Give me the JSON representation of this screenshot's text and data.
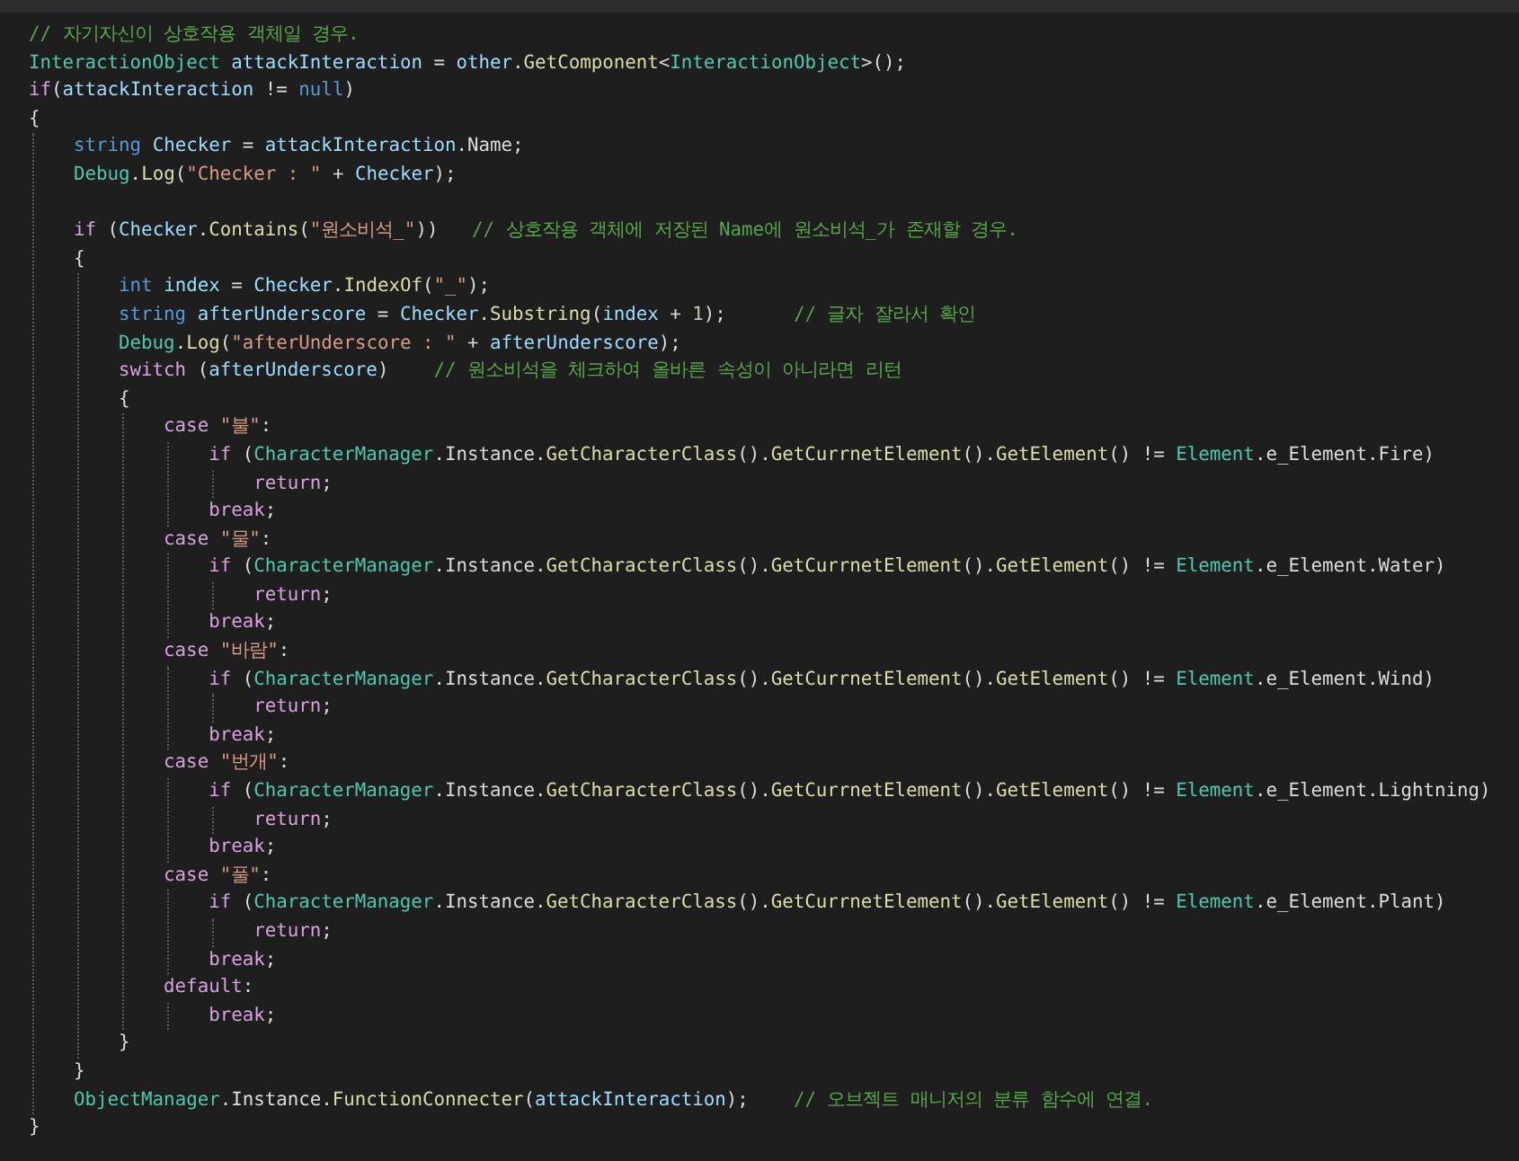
{
  "editor": {
    "lines": [
      {
        "kind": "code",
        "tokens": [
          {
            "kind": "comment",
            "text": "// 자기자신이 상호작용 객체일 경우."
          }
        ]
      },
      {
        "kind": "code",
        "tokens": [
          {
            "kind": "type",
            "text": "InteractionObject "
          },
          {
            "kind": "variable",
            "text": "attackInteraction"
          },
          {
            "kind": "plain",
            "text": " = "
          },
          {
            "kind": "variable",
            "text": "other"
          },
          {
            "kind": "plain",
            "text": "."
          },
          {
            "kind": "method",
            "text": "GetComponent"
          },
          {
            "kind": "plain",
            "text": "<"
          },
          {
            "kind": "type",
            "text": "InteractionObject"
          },
          {
            "kind": "plain",
            "text": ">();"
          }
        ]
      },
      {
        "kind": "code",
        "tokens": [
          {
            "kind": "control",
            "text": "if"
          },
          {
            "kind": "plain",
            "text": "("
          },
          {
            "kind": "variable",
            "text": "attackInteraction"
          },
          {
            "kind": "plain",
            "text": " != "
          },
          {
            "kind": "keyword",
            "text": "null"
          },
          {
            "kind": "plain",
            "text": ")"
          }
        ]
      },
      {
        "kind": "code",
        "tokens": [
          {
            "kind": "plain",
            "text": "{"
          }
        ],
        "children": [
          {
            "kind": "code",
            "tokens": [
              {
                "kind": "keyword",
                "text": "string "
              },
              {
                "kind": "variable",
                "text": "Checker"
              },
              {
                "kind": "plain",
                "text": " = "
              },
              {
                "kind": "variable",
                "text": "attackInteraction"
              },
              {
                "kind": "plain",
                "text": ".Name;"
              }
            ]
          },
          {
            "kind": "code",
            "tokens": [
              {
                "kind": "type",
                "text": "Debug"
              },
              {
                "kind": "plain",
                "text": "."
              },
              {
                "kind": "method",
                "text": "Log"
              },
              {
                "kind": "plain",
                "text": "("
              },
              {
                "kind": "string",
                "text": "\"Checker : \""
              },
              {
                "kind": "plain",
                "text": " + "
              },
              {
                "kind": "variable",
                "text": "Checker"
              },
              {
                "kind": "plain",
                "text": ");"
              }
            ]
          },
          {
            "kind": "blank"
          },
          {
            "kind": "code",
            "tokens": [
              {
                "kind": "control",
                "text": "if"
              },
              {
                "kind": "plain",
                "text": " ("
              },
              {
                "kind": "variable",
                "text": "Checker"
              },
              {
                "kind": "plain",
                "text": "."
              },
              {
                "kind": "method",
                "text": "Contains"
              },
              {
                "kind": "plain",
                "text": "("
              },
              {
                "kind": "string",
                "text": "\"원소비석_\""
              },
              {
                "kind": "plain",
                "text": "))   "
              },
              {
                "kind": "comment",
                "text": "// 상호작용 객체에 저장된 Name에 원소비석_가 존재할 경우."
              }
            ]
          },
          {
            "kind": "code",
            "tokens": [
              {
                "kind": "plain",
                "text": "{"
              }
            ],
            "children": [
              {
                "kind": "code",
                "tokens": [
                  {
                    "kind": "keyword",
                    "text": "int "
                  },
                  {
                    "kind": "variable",
                    "text": "index"
                  },
                  {
                    "kind": "plain",
                    "text": " = "
                  },
                  {
                    "kind": "variable",
                    "text": "Checker"
                  },
                  {
                    "kind": "plain",
                    "text": "."
                  },
                  {
                    "kind": "method",
                    "text": "IndexOf"
                  },
                  {
                    "kind": "plain",
                    "text": "("
                  },
                  {
                    "kind": "string",
                    "text": "\"_\""
                  },
                  {
                    "kind": "plain",
                    "text": ");"
                  }
                ]
              },
              {
                "kind": "code",
                "tokens": [
                  {
                    "kind": "keyword",
                    "text": "string "
                  },
                  {
                    "kind": "variable",
                    "text": "afterUnderscore"
                  },
                  {
                    "kind": "plain",
                    "text": " = "
                  },
                  {
                    "kind": "variable",
                    "text": "Checker"
                  },
                  {
                    "kind": "plain",
                    "text": "."
                  },
                  {
                    "kind": "method",
                    "text": "Substring"
                  },
                  {
                    "kind": "plain",
                    "text": "("
                  },
                  {
                    "kind": "variable",
                    "text": "index"
                  },
                  {
                    "kind": "plain",
                    "text": " + "
                  },
                  {
                    "kind": "number",
                    "text": "1"
                  },
                  {
                    "kind": "plain",
                    "text": ");      "
                  },
                  {
                    "kind": "comment",
                    "text": "// 글자 잘라서 확인"
                  }
                ]
              },
              {
                "kind": "code",
                "tokens": [
                  {
                    "kind": "type",
                    "text": "Debug"
                  },
                  {
                    "kind": "plain",
                    "text": "."
                  },
                  {
                    "kind": "method",
                    "text": "Log"
                  },
                  {
                    "kind": "plain",
                    "text": "("
                  },
                  {
                    "kind": "string",
                    "text": "\"afterUnderscore : \""
                  },
                  {
                    "kind": "plain",
                    "text": " + "
                  },
                  {
                    "kind": "variable",
                    "text": "afterUnderscore"
                  },
                  {
                    "kind": "plain",
                    "text": ");"
                  }
                ]
              },
              {
                "kind": "code",
                "tokens": [
                  {
                    "kind": "control",
                    "text": "switch"
                  },
                  {
                    "kind": "plain",
                    "text": " ("
                  },
                  {
                    "kind": "variable",
                    "text": "afterUnderscore"
                  },
                  {
                    "kind": "plain",
                    "text": ")    "
                  },
                  {
                    "kind": "comment",
                    "text": "// 원소비석을 체크하여 올바른 속성이 아니라면 리턴"
                  }
                ]
              },
              {
                "kind": "code",
                "tokens": [
                  {
                    "kind": "plain",
                    "text": "{"
                  }
                ],
                "children": [
                  {
                    "kind": "code",
                    "tokens": [
                      {
                        "kind": "control",
                        "text": "case "
                      },
                      {
                        "kind": "string",
                        "text": "\"불\""
                      },
                      {
                        "kind": "plain",
                        "text": ":"
                      }
                    ],
                    "children": [
                      {
                        "kind": "code",
                        "tokens": [
                          {
                            "kind": "control",
                            "text": "if"
                          },
                          {
                            "kind": "plain",
                            "text": " ("
                          },
                          {
                            "kind": "type",
                            "text": "CharacterManager"
                          },
                          {
                            "kind": "plain",
                            "text": ".Instance."
                          },
                          {
                            "kind": "method",
                            "text": "GetCharacterClass"
                          },
                          {
                            "kind": "plain",
                            "text": "()."
                          },
                          {
                            "kind": "method",
                            "text": "GetCurrnetElement"
                          },
                          {
                            "kind": "plain",
                            "text": "()."
                          },
                          {
                            "kind": "method",
                            "text": "GetElement"
                          },
                          {
                            "kind": "plain",
                            "text": "() != "
                          },
                          {
                            "kind": "type",
                            "text": "Element"
                          },
                          {
                            "kind": "plain",
                            "text": ".e_Element.Fire)"
                          }
                        ],
                        "children": [
                          {
                            "kind": "code",
                            "tokens": [
                              {
                                "kind": "control",
                                "text": "return"
                              },
                              {
                                "kind": "plain",
                                "text": ";"
                              }
                            ]
                          }
                        ]
                      },
                      {
                        "kind": "code",
                        "tokens": [
                          {
                            "kind": "control",
                            "text": "break"
                          },
                          {
                            "kind": "plain",
                            "text": ";"
                          }
                        ]
                      }
                    ]
                  },
                  {
                    "kind": "code",
                    "tokens": [
                      {
                        "kind": "control",
                        "text": "case "
                      },
                      {
                        "kind": "string",
                        "text": "\"물\""
                      },
                      {
                        "kind": "plain",
                        "text": ":"
                      }
                    ],
                    "children": [
                      {
                        "kind": "code",
                        "tokens": [
                          {
                            "kind": "control",
                            "text": "if"
                          },
                          {
                            "kind": "plain",
                            "text": " ("
                          },
                          {
                            "kind": "type",
                            "text": "CharacterManager"
                          },
                          {
                            "kind": "plain",
                            "text": ".Instance."
                          },
                          {
                            "kind": "method",
                            "text": "GetCharacterClass"
                          },
                          {
                            "kind": "plain",
                            "text": "()."
                          },
                          {
                            "kind": "method",
                            "text": "GetCurrnetElement"
                          },
                          {
                            "kind": "plain",
                            "text": "()."
                          },
                          {
                            "kind": "method",
                            "text": "GetElement"
                          },
                          {
                            "kind": "plain",
                            "text": "() != "
                          },
                          {
                            "kind": "type",
                            "text": "Element"
                          },
                          {
                            "kind": "plain",
                            "text": ".e_Element.Water)"
                          }
                        ],
                        "children": [
                          {
                            "kind": "code",
                            "tokens": [
                              {
                                "kind": "control",
                                "text": "return"
                              },
                              {
                                "kind": "plain",
                                "text": ";"
                              }
                            ]
                          }
                        ]
                      },
                      {
                        "kind": "code",
                        "tokens": [
                          {
                            "kind": "control",
                            "text": "break"
                          },
                          {
                            "kind": "plain",
                            "text": ";"
                          }
                        ]
                      }
                    ]
                  },
                  {
                    "kind": "code",
                    "tokens": [
                      {
                        "kind": "control",
                        "text": "case "
                      },
                      {
                        "kind": "string",
                        "text": "\"바람\""
                      },
                      {
                        "kind": "plain",
                        "text": ":"
                      }
                    ],
                    "children": [
                      {
                        "kind": "code",
                        "tokens": [
                          {
                            "kind": "control",
                            "text": "if"
                          },
                          {
                            "kind": "plain",
                            "text": " ("
                          },
                          {
                            "kind": "type",
                            "text": "CharacterManager"
                          },
                          {
                            "kind": "plain",
                            "text": ".Instance."
                          },
                          {
                            "kind": "method",
                            "text": "GetCharacterClass"
                          },
                          {
                            "kind": "plain",
                            "text": "()."
                          },
                          {
                            "kind": "method",
                            "text": "GetCurrnetElement"
                          },
                          {
                            "kind": "plain",
                            "text": "()."
                          },
                          {
                            "kind": "method",
                            "text": "GetElement"
                          },
                          {
                            "kind": "plain",
                            "text": "() != "
                          },
                          {
                            "kind": "type",
                            "text": "Element"
                          },
                          {
                            "kind": "plain",
                            "text": ".e_Element.Wind)"
                          }
                        ],
                        "children": [
                          {
                            "kind": "code",
                            "tokens": [
                              {
                                "kind": "control",
                                "text": "return"
                              },
                              {
                                "kind": "plain",
                                "text": ";"
                              }
                            ]
                          }
                        ]
                      },
                      {
                        "kind": "code",
                        "tokens": [
                          {
                            "kind": "control",
                            "text": "break"
                          },
                          {
                            "kind": "plain",
                            "text": ";"
                          }
                        ]
                      }
                    ]
                  },
                  {
                    "kind": "code",
                    "tokens": [
                      {
                        "kind": "control",
                        "text": "case "
                      },
                      {
                        "kind": "string",
                        "text": "\"번개\""
                      },
                      {
                        "kind": "plain",
                        "text": ":"
                      }
                    ],
                    "children": [
                      {
                        "kind": "code",
                        "tokens": [
                          {
                            "kind": "control",
                            "text": "if"
                          },
                          {
                            "kind": "plain",
                            "text": " ("
                          },
                          {
                            "kind": "type",
                            "text": "CharacterManager"
                          },
                          {
                            "kind": "plain",
                            "text": ".Instance."
                          },
                          {
                            "kind": "method",
                            "text": "GetCharacterClass"
                          },
                          {
                            "kind": "plain",
                            "text": "()."
                          },
                          {
                            "kind": "method",
                            "text": "GetCurrnetElement"
                          },
                          {
                            "kind": "plain",
                            "text": "()."
                          },
                          {
                            "kind": "method",
                            "text": "GetElement"
                          },
                          {
                            "kind": "plain",
                            "text": "() != "
                          },
                          {
                            "kind": "type",
                            "text": "Element"
                          },
                          {
                            "kind": "plain",
                            "text": ".e_Element.Lightning)"
                          }
                        ],
                        "children": [
                          {
                            "kind": "code",
                            "tokens": [
                              {
                                "kind": "control",
                                "text": "return"
                              },
                              {
                                "kind": "plain",
                                "text": ";"
                              }
                            ]
                          }
                        ]
                      },
                      {
                        "kind": "code",
                        "tokens": [
                          {
                            "kind": "control",
                            "text": "break"
                          },
                          {
                            "kind": "plain",
                            "text": ";"
                          }
                        ]
                      }
                    ]
                  },
                  {
                    "kind": "code",
                    "tokens": [
                      {
                        "kind": "control",
                        "text": "case "
                      },
                      {
                        "kind": "string",
                        "text": "\"풀\""
                      },
                      {
                        "kind": "plain",
                        "text": ":"
                      }
                    ],
                    "children": [
                      {
                        "kind": "code",
                        "tokens": [
                          {
                            "kind": "control",
                            "text": "if"
                          },
                          {
                            "kind": "plain",
                            "text": " ("
                          },
                          {
                            "kind": "type",
                            "text": "CharacterManager"
                          },
                          {
                            "kind": "plain",
                            "text": ".Instance."
                          },
                          {
                            "kind": "method",
                            "text": "GetCharacterClass"
                          },
                          {
                            "kind": "plain",
                            "text": "()."
                          },
                          {
                            "kind": "method",
                            "text": "GetCurrnetElement"
                          },
                          {
                            "kind": "plain",
                            "text": "()."
                          },
                          {
                            "kind": "method",
                            "text": "GetElement"
                          },
                          {
                            "kind": "plain",
                            "text": "() != "
                          },
                          {
                            "kind": "type",
                            "text": "Element"
                          },
                          {
                            "kind": "plain",
                            "text": ".e_Element.Plant)"
                          }
                        ],
                        "children": [
                          {
                            "kind": "code",
                            "tokens": [
                              {
                                "kind": "control",
                                "text": "return"
                              },
                              {
                                "kind": "plain",
                                "text": ";"
                              }
                            ]
                          }
                        ]
                      },
                      {
                        "kind": "code",
                        "tokens": [
                          {
                            "kind": "control",
                            "text": "break"
                          },
                          {
                            "kind": "plain",
                            "text": ";"
                          }
                        ]
                      }
                    ]
                  },
                  {
                    "kind": "code",
                    "tokens": [
                      {
                        "kind": "control",
                        "text": "default"
                      },
                      {
                        "kind": "plain",
                        "text": ":"
                      }
                    ],
                    "children": [
                      {
                        "kind": "code",
                        "tokens": [
                          {
                            "kind": "control",
                            "text": "break"
                          },
                          {
                            "kind": "plain",
                            "text": ";"
                          }
                        ]
                      }
                    ]
                  }
                ]
              },
              {
                "kind": "code",
                "tokens": [
                  {
                    "kind": "plain",
                    "text": "}"
                  }
                ]
              }
            ]
          },
          {
            "kind": "code",
            "tokens": [
              {
                "kind": "plain",
                "text": "}"
              }
            ]
          },
          {
            "kind": "code",
            "tokens": [
              {
                "kind": "type",
                "text": "ObjectManager"
              },
              {
                "kind": "plain",
                "text": ".Instance."
              },
              {
                "kind": "method",
                "text": "FunctionConnecter"
              },
              {
                "kind": "plain",
                "text": "("
              },
              {
                "kind": "variable",
                "text": "attackInteraction"
              },
              {
                "kind": "plain",
                "text": ");    "
              },
              {
                "kind": "comment",
                "text": "// 오브젝트 매니저의 분류 함수에 연결."
              }
            ]
          }
        ]
      },
      {
        "kind": "code",
        "tokens": [
          {
            "kind": "plain",
            "text": "}"
          }
        ]
      }
    ]
  }
}
